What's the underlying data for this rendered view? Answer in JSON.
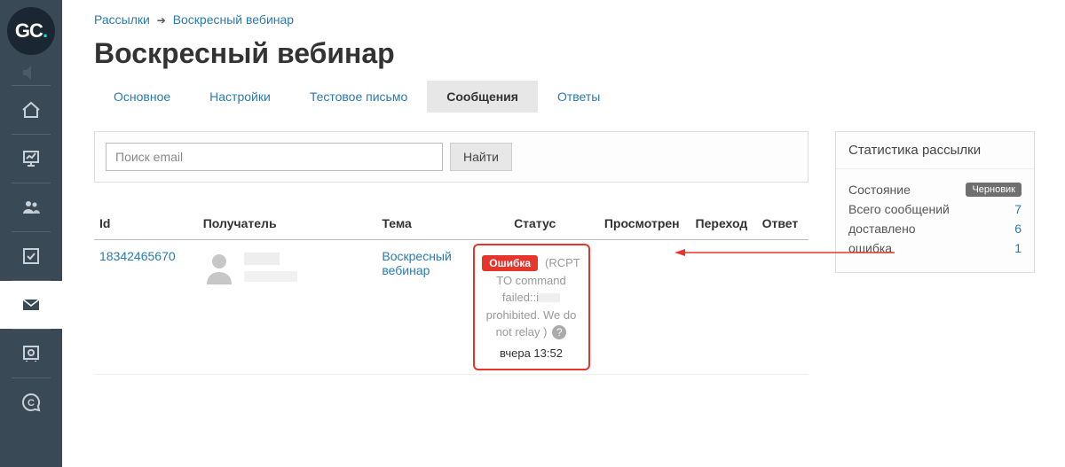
{
  "logo": {
    "g": "G",
    "c": "C",
    "dot": "."
  },
  "breadcrumb": {
    "root": "Рассылки",
    "current": "Воскресный вебинар"
  },
  "page_title": "Воскресный вебинар",
  "tabs": [
    {
      "label": "Основное"
    },
    {
      "label": "Настройки"
    },
    {
      "label": "Тестовое письмо"
    },
    {
      "label": "Сообщения",
      "active": true
    },
    {
      "label": "Ответы"
    }
  ],
  "search": {
    "placeholder": "Поиск email",
    "find_label": "Найти"
  },
  "table": {
    "headers": {
      "id": "Id",
      "recipient": "Получатель",
      "subject": "Тема",
      "status": "Статус",
      "viewed": "Просмотрен",
      "click": "Переход",
      "reply": "Ответ"
    },
    "rows": [
      {
        "id": "18342465670",
        "subject": "Воскресный вебинар",
        "status_badge": "Ошибка",
        "status_msg1": "(RCPT TO command failed::i",
        "status_msg2": " prohibited. We do not relay )",
        "status_time": "вчера 13:52"
      }
    ]
  },
  "stats": {
    "title": "Статистика рассылки",
    "state_label": "Состояние",
    "state_value": "Черновик",
    "total_label": "Всего сообщений",
    "total_value": "7",
    "delivered_label": "доставлено",
    "delivered_value": "6",
    "error_label": "ошибка",
    "error_value": "1"
  }
}
